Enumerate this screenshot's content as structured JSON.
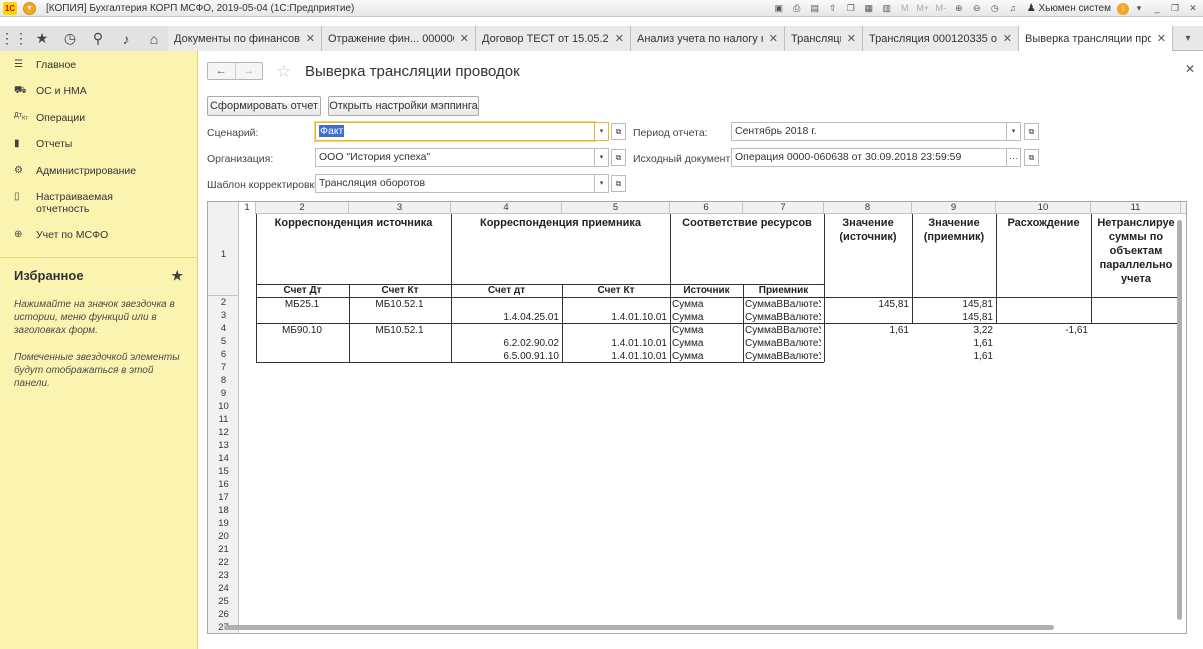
{
  "window": {
    "title": "[КОПИЯ] Бухгалтерия КОРП МСФО, 2019-05-04 (1С:Предприятие)",
    "user": "Хьюмен систем"
  },
  "tabs": [
    {
      "label": "Документы по финансовы..."
    },
    {
      "label": "Отражение фин... 000000023"
    },
    {
      "label": "Договор ТЕСТ от 15.05.20..."
    },
    {
      "label": "Анализ учета по налогу н..."
    },
    {
      "label": "Трансляции"
    },
    {
      "label": "Трансляция 000120335 от ..."
    },
    {
      "label": "Выверка трансляции пров..."
    }
  ],
  "sidebar": {
    "items": [
      {
        "label": "Главное",
        "icon": "menu-icon"
      },
      {
        "label": "ОС и НМА",
        "icon": "truck-icon"
      },
      {
        "label": "Операции",
        "icon": "dt-kt-icon"
      },
      {
        "label": "Отчеты",
        "icon": "bar-chart-icon"
      },
      {
        "label": "Администрирование",
        "icon": "gear-icon"
      },
      {
        "label": "Настраиваемая отчетность",
        "icon": "book-icon"
      },
      {
        "label": "Учет по МСФО",
        "icon": "globe-icon"
      }
    ],
    "favorites": {
      "title": "Избранное",
      "hint1": "Нажимайте на значок звездочка в истории, меню функций или в заголовках форм.",
      "hint2": "Помеченные звездочкой элементы будут отображаться в этой панели."
    }
  },
  "page": {
    "title": "Выверка трансляции проводок"
  },
  "toolbar": {
    "generate": "Сформировать отчет",
    "open_mapping": "Открыть настройки мэппинга"
  },
  "form": {
    "scenario_label": "Сценарий:",
    "scenario": "Факт",
    "org_label": "Организация:",
    "org": "ООО \"История успеха\"",
    "template_label": "Шаблон корректировки:",
    "template": "Трансляция оборотов",
    "period_label": "Период отчета:",
    "period": "Сентябрь 2018 г.",
    "source_doc_label": "Исходный документ:",
    "source_doc": "Операция 0000-060638 от 30.09.2018 23:59:59"
  },
  "sheet": {
    "col_numbers": [
      "1",
      "2",
      "3",
      "4",
      "5",
      "6",
      "7",
      "8",
      "9",
      "10",
      "11"
    ],
    "row_numbers": [
      "1",
      "2",
      "3",
      "4",
      "5",
      "6",
      "7",
      "8",
      "9",
      "10",
      "11",
      "12",
      "13",
      "14",
      "15",
      "16",
      "17",
      "18",
      "19",
      "20",
      "21",
      "22",
      "23",
      "24",
      "25",
      "26",
      "27",
      "28"
    ],
    "headers": {
      "source_corr": "Корреспонденция источника",
      "target_corr": "Корреспонденция приемника",
      "resources": "Соответствие ресурсов",
      "value_src": "Значение (источник)",
      "value_tgt": "Значение (приемник)",
      "diff": "Расхождение",
      "untranslated": "Нетранслируе суммы по объектам параллельно учета",
      "dt": "Счет Дт",
      "kt": "Счет Кт",
      "dt2": "Счет дт",
      "kt2": "Счет Кт",
      "src": "Источник",
      "tgt": "Приемник"
    },
    "rows": [
      {
        "dt": "МБ25.1",
        "kt": "МБ10.52.1",
        "dt2": "",
        "kt2": "",
        "src": "Сумма",
        "tgt": "СуммаВВалютеУ",
        "v1": "145,81",
        "v2": "145,81",
        "diff": ""
      },
      {
        "dt": "",
        "kt": "",
        "dt2": "1.4.04.25.01",
        "kt2": "1.4.01.10.01",
        "src": "Сумма",
        "tgt": "СуммаВВалютеУ",
        "v1": "",
        "v2": "145,81",
        "diff": ""
      },
      {
        "dt": "МБ90.10",
        "kt": "МБ10.52.1",
        "dt2": "",
        "kt2": "",
        "src": "Сумма",
        "tgt": "СуммаВВалютеУ",
        "v1": "1,61",
        "v2": "3,22",
        "diff": "-1,61"
      },
      {
        "dt": "",
        "kt": "",
        "dt2": "6.2.02.90.02",
        "kt2": "1.4.01.10.01",
        "src": "Сумма",
        "tgt": "СуммаВВалютеУ",
        "v1": "",
        "v2": "1,61",
        "diff": ""
      },
      {
        "dt": "",
        "kt": "",
        "dt2": "6.5.00.91.10",
        "kt2": "1.4.01.10.01",
        "src": "Сумма",
        "tgt": "СуммаВВалютеУ",
        "v1": "",
        "v2": "1,61",
        "diff": ""
      }
    ]
  }
}
